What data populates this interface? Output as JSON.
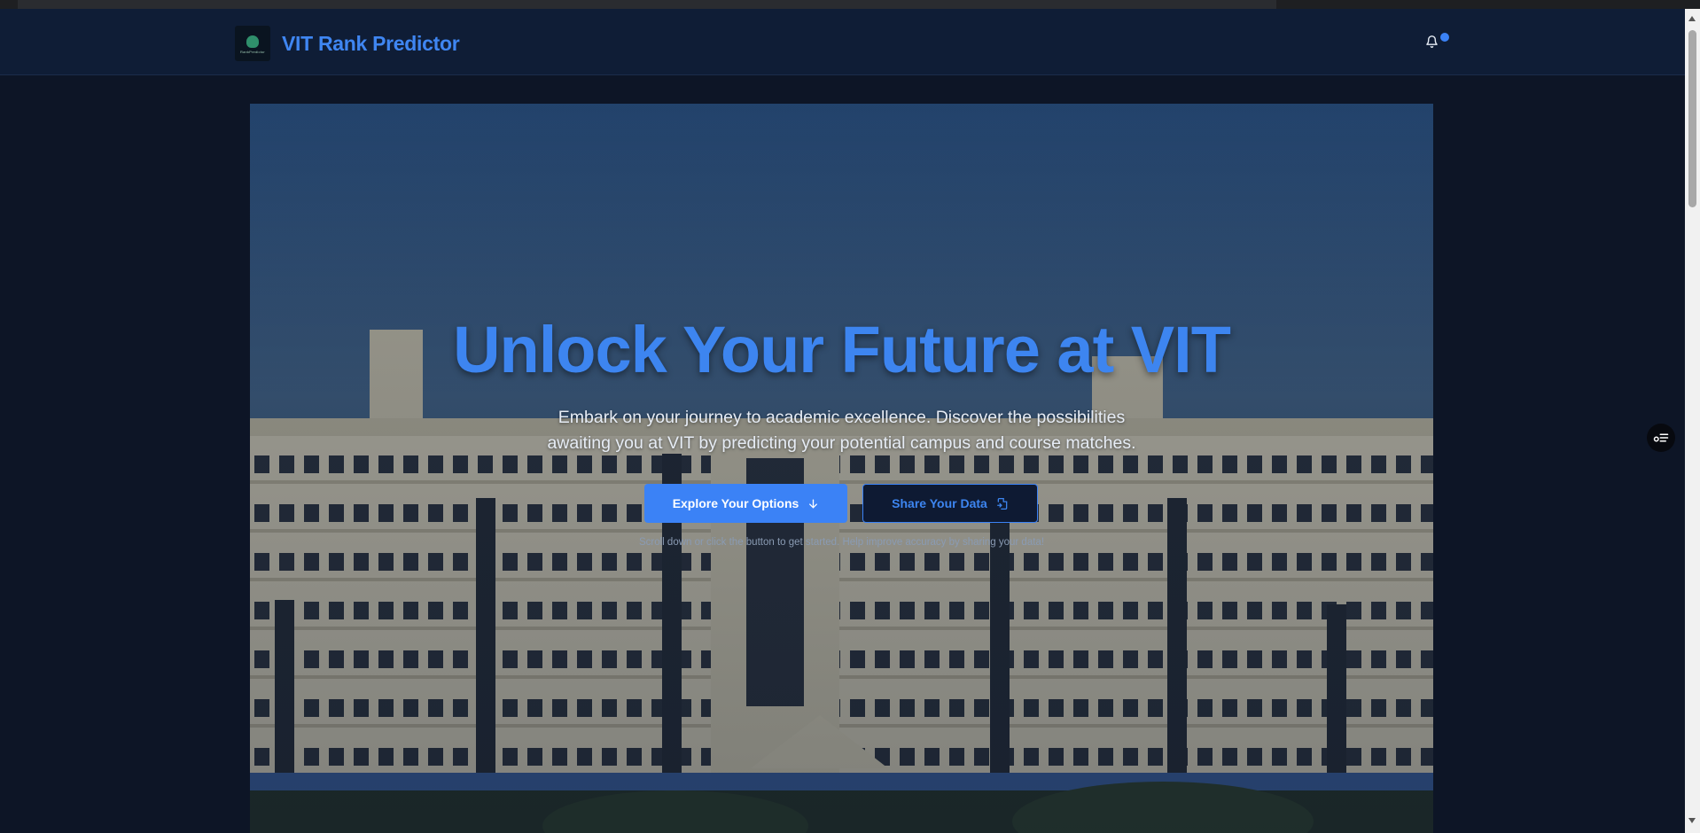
{
  "navbar": {
    "brand_title": "VIT Rank Predictor",
    "logo_text": "RankPredictor",
    "logo_icon": "tree-logo-icon",
    "notification_icon": "bell-icon",
    "has_unread": true
  },
  "hero": {
    "title": "Unlock Your Future at VIT",
    "subtitle_line1": "Embark on your journey to academic excellence. Discover the possibilities",
    "subtitle_line2": "awaiting you at VIT by predicting your potential campus and course matches.",
    "primary_button": {
      "label": "Explore Your Options",
      "icon": "arrow-down-icon"
    },
    "secondary_button": {
      "label": "Share Your Data",
      "icon": "file-share-icon"
    },
    "hint": "Scroll down or click the button to get started. Help improve accuracy by sharing your data!",
    "background_image": "vit-campus-building-photo"
  },
  "floating_action": {
    "icon": "settings-list-icon"
  },
  "colors": {
    "accent": "#3b82f6",
    "navbar_bg": "#0f1d36",
    "page_bg": "#0d1526"
  }
}
